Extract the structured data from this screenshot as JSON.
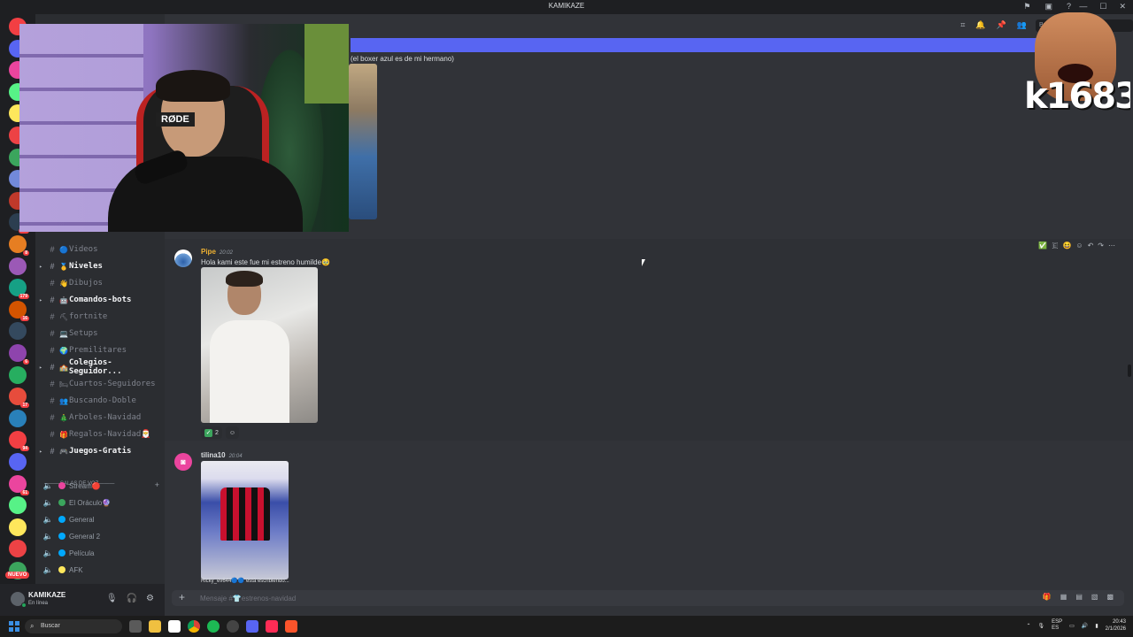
{
  "window": {
    "title": "KAMIKAZE",
    "controls": [
      "—",
      "☐",
      "✕"
    ]
  },
  "guild_badges": [
    "281",
    "8",
    "179",
    "16",
    "6",
    "17",
    "94",
    "61"
  ],
  "guild_colors": [
    "#f23f43",
    "#5865f2",
    "#eb459e",
    "#57f287",
    "#fee75c",
    "#ed4245",
    "#3ba55d",
    "#7289da",
    "#c0392b",
    "#2c3e50",
    "#e67e22",
    "#9b59b6",
    "#16a085",
    "#d35400",
    "#34495e",
    "#8e44ad",
    "#27ae60",
    "#e74c3c",
    "#2980b9"
  ],
  "nuevo_label": "NUEVO",
  "channels": {
    "items": [
      {
        "label": "Videos",
        "emoji": "🔵",
        "bold": false,
        "arrow": false
      },
      {
        "label": "Niveles",
        "emoji": "🥇",
        "bold": true,
        "arrow": true
      },
      {
        "label": "Dibujos",
        "emoji": "👋",
        "bold": false,
        "arrow": false
      },
      {
        "label": "Comandos-bots",
        "emoji": "🤖",
        "bold": true,
        "arrow": true
      },
      {
        "label": "fortnite",
        "emoji": "⛏",
        "bold": false,
        "arrow": false
      },
      {
        "label": "Setups",
        "emoji": "💻",
        "bold": false,
        "arrow": false
      },
      {
        "label": "Premilitares",
        "emoji": "🌍",
        "bold": false,
        "arrow": false
      },
      {
        "label": "Colegios-Seguidor...",
        "emoji": "🏫",
        "bold": true,
        "arrow": true
      },
      {
        "label": "Cuartos-Seguidores",
        "emoji": "🛏",
        "bold": false,
        "arrow": false
      },
      {
        "label": "Buscando-Doble",
        "emoji": "👥",
        "bold": false,
        "arrow": false
      },
      {
        "label": "Arboles-Navidad",
        "emoji": "🎄",
        "bold": false,
        "arrow": false
      },
      {
        "label": "Regalos-Navidad🎅",
        "emoji": "🎁",
        "bold": false,
        "arrow": false
      },
      {
        "label": "Juegos-Gratis",
        "emoji": "🎮",
        "bold": true,
        "arrow": true
      }
    ],
    "voice_header": "———SALAS DE VOZ———",
    "voice_items": [
      {
        "label": "Stream🔴",
        "color": "#eb459e"
      },
      {
        "label": "El Oráculo🔮",
        "color": "#3ba55d"
      },
      {
        "label": "General",
        "color": "#00a8fc"
      },
      {
        "label": "General 2",
        "color": "#00a8fc"
      },
      {
        "label": "Película",
        "color": "#00a8fc"
      },
      {
        "label": "AFK",
        "color": "#fee75c"
      }
    ]
  },
  "user": {
    "name": "KAMIKAZE",
    "status": "En línea"
  },
  "topbar": {
    "search_placeholder": "Buscar"
  },
  "messages": {
    "prev_text": "(el boxer azul es de mi hermano)",
    "msg1": {
      "user": "Pipe",
      "time": "20:02",
      "text": "Hola kami este fue mi estreno humilde🥹",
      "reaction_count": "2",
      "user_color": "#f0b232"
    },
    "msg2": {
      "user": "tilina10",
      "time": "20:04",
      "user_color": "#dbdee1"
    },
    "typing": "Ricky_ev644🔵🔵 está escribiendo..."
  },
  "composer": {
    "placeholder": "Mensaje #👕estrenos-navidad"
  },
  "overlay": {
    "cam_brand": "RØDE",
    "cam2_label": "k1683"
  },
  "taskbar": {
    "search_label": "Buscar",
    "lang": "ESP\nES",
    "time": "20:43",
    "date": "2/1/2026"
  }
}
